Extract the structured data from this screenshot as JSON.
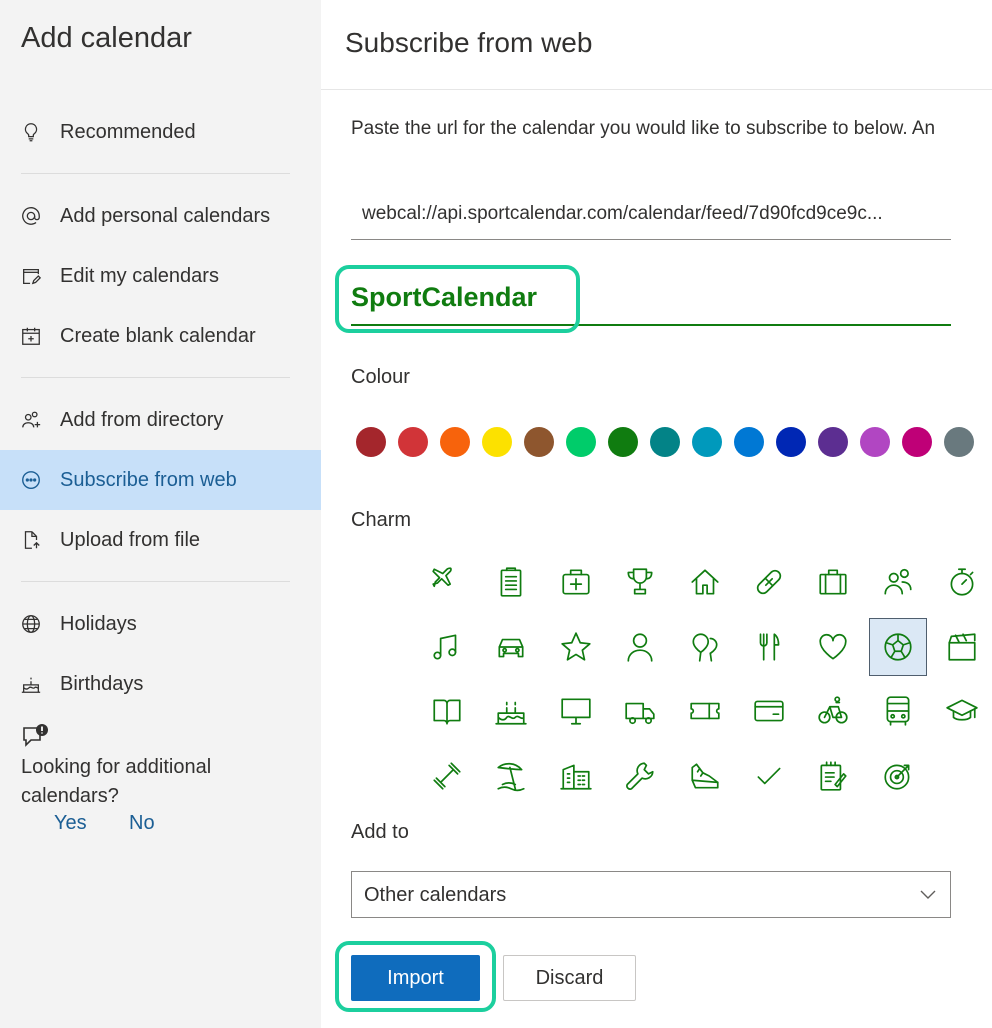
{
  "sidebar": {
    "title": "Add calendar",
    "items": [
      {
        "label": "Recommended",
        "icon": "lightbulb-icon"
      },
      {
        "label": "Add personal calendars",
        "icon": "at-sign-icon"
      },
      {
        "label": "Edit my calendars",
        "icon": "edit-calendar-icon"
      },
      {
        "label": "Create blank calendar",
        "icon": "calendar-add-icon"
      },
      {
        "label": "Add from directory",
        "icon": "people-add-icon"
      },
      {
        "label": "Subscribe from web",
        "icon": "globe-link-icon",
        "active": true
      },
      {
        "label": "Upload from file",
        "icon": "file-upload-icon"
      },
      {
        "label": "Holidays",
        "icon": "globe-icon"
      },
      {
        "label": "Birthdays",
        "icon": "cake-icon"
      }
    ],
    "prompt": {
      "text": "Looking for additional calendars?",
      "yes": "Yes",
      "no": "No"
    }
  },
  "main": {
    "title": "Subscribe from web",
    "instruction": "Paste the url for the calendar you would like to subscribe to below. An",
    "url_value": "webcal://api.sportcalendar.com/calendar/feed/7d90fcd9ce9c...",
    "name_value": "SportCalendar",
    "colour_label": "Colour",
    "colours": [
      "#a4262c",
      "#d13438",
      "#f7630c",
      "#fce100",
      "#8e562e",
      "#00cc6a",
      "#107c10",
      "#038387",
      "#0099bc",
      "#0078d4",
      "#0027b4",
      "#5c2e91",
      "#b146c2",
      "#bf0077",
      "#69797e"
    ],
    "charm_label": "Charm",
    "charms": [
      "airplane-icon",
      "clipboard-icon",
      "medkit-icon",
      "trophy-icon",
      "home-icon",
      "bandage-icon",
      "briefcase-icon",
      "people-icon",
      "stopwatch-icon",
      "music-note-icon",
      "car-icon",
      "star-icon",
      "person-icon",
      "balloon-icon",
      "utensils-icon",
      "heart-icon",
      "soccer-ball-icon",
      "clapperboard-icon",
      "book-icon",
      "cake-icon",
      "monitor-icon",
      "truck-icon",
      "ticket-icon",
      "credit-card-icon",
      "bicycle-icon",
      "bus-icon",
      "graduation-cap-icon",
      "dumbbell-icon",
      "beach-icon",
      "building-icon",
      "wrench-icon",
      "sneaker-icon",
      "checkmark-icon",
      "notepad-icon",
      "target-icon"
    ],
    "selected_charm": "soccer-ball-icon",
    "add_to_label": "Add to",
    "add_to_value": "Other calendars",
    "import_label": "Import",
    "discard_label": "Discard",
    "accent_color": "#107c10",
    "highlight_color": "#1ccf9e"
  }
}
